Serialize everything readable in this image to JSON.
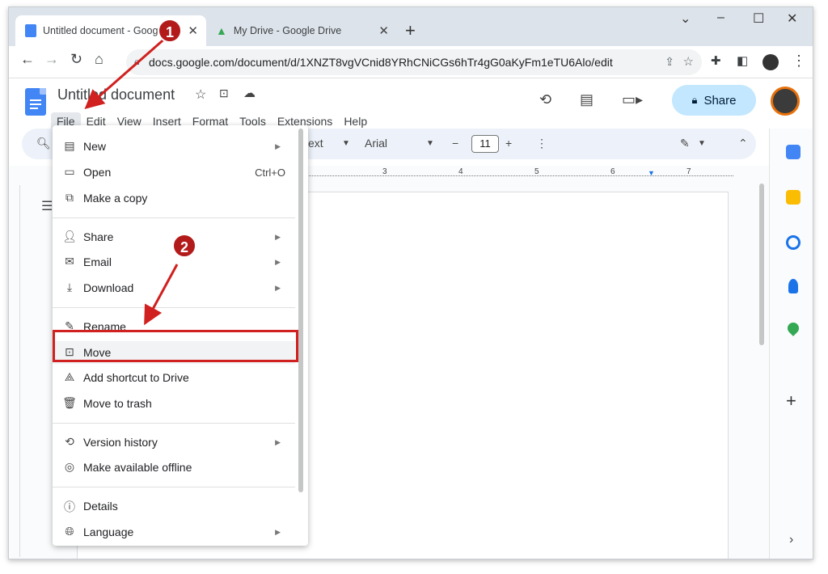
{
  "browser": {
    "tabs": [
      {
        "title": "Untitled document - Google Docs",
        "icon": "docs-icon"
      },
      {
        "title": "My Drive - Google Drive",
        "icon": "drive-icon"
      }
    ],
    "url": "docs.google.com/document/d/1XNZT8vgVCnid8YRhCNiCGs6hTr4gG0aKyFm1eTU6Alo/edit"
  },
  "doc": {
    "title": "Untitled document",
    "menus": [
      "File",
      "Edit",
      "View",
      "Insert",
      "Format",
      "Tools",
      "Extensions",
      "Help"
    ],
    "share_label": "Share"
  },
  "toolbar": {
    "style": "ext",
    "font": "Arial",
    "size": "11"
  },
  "ruler_ticks": [
    "3",
    "4",
    "5",
    "6",
    "7"
  ],
  "file_menu": [
    {
      "label": "New",
      "icon": "doc-icon",
      "submenu": true
    },
    {
      "label": "Open",
      "icon": "folder-icon",
      "shortcut": "Ctrl+O"
    },
    {
      "label": "Make a copy",
      "icon": "copy-icon"
    },
    {
      "label": "Share",
      "icon": "person-add-icon",
      "submenu": true
    },
    {
      "label": "Email",
      "icon": "mail-icon",
      "submenu": true
    },
    {
      "label": "Download",
      "icon": "download-icon",
      "submenu": true
    },
    {
      "label": "Rename",
      "icon": "rename-icon"
    },
    {
      "label": "Move",
      "icon": "move-folder-icon"
    },
    {
      "label": "Add shortcut to Drive",
      "icon": "drive-shortcut-icon"
    },
    {
      "label": "Move to trash",
      "icon": "trash-icon"
    },
    {
      "label": "Version history",
      "icon": "history-icon",
      "submenu": true
    },
    {
      "label": "Make available offline",
      "icon": "offline-icon"
    },
    {
      "label": "Details",
      "icon": "info-icon"
    },
    {
      "label": "Language",
      "icon": "globe-icon",
      "submenu": true
    }
  ],
  "annotations": {
    "badge1": "1",
    "badge2": "2"
  },
  "colors": {
    "accent": "#c2e7ff",
    "annotation": "#d0201f",
    "docs_blue": "#4285f4"
  }
}
